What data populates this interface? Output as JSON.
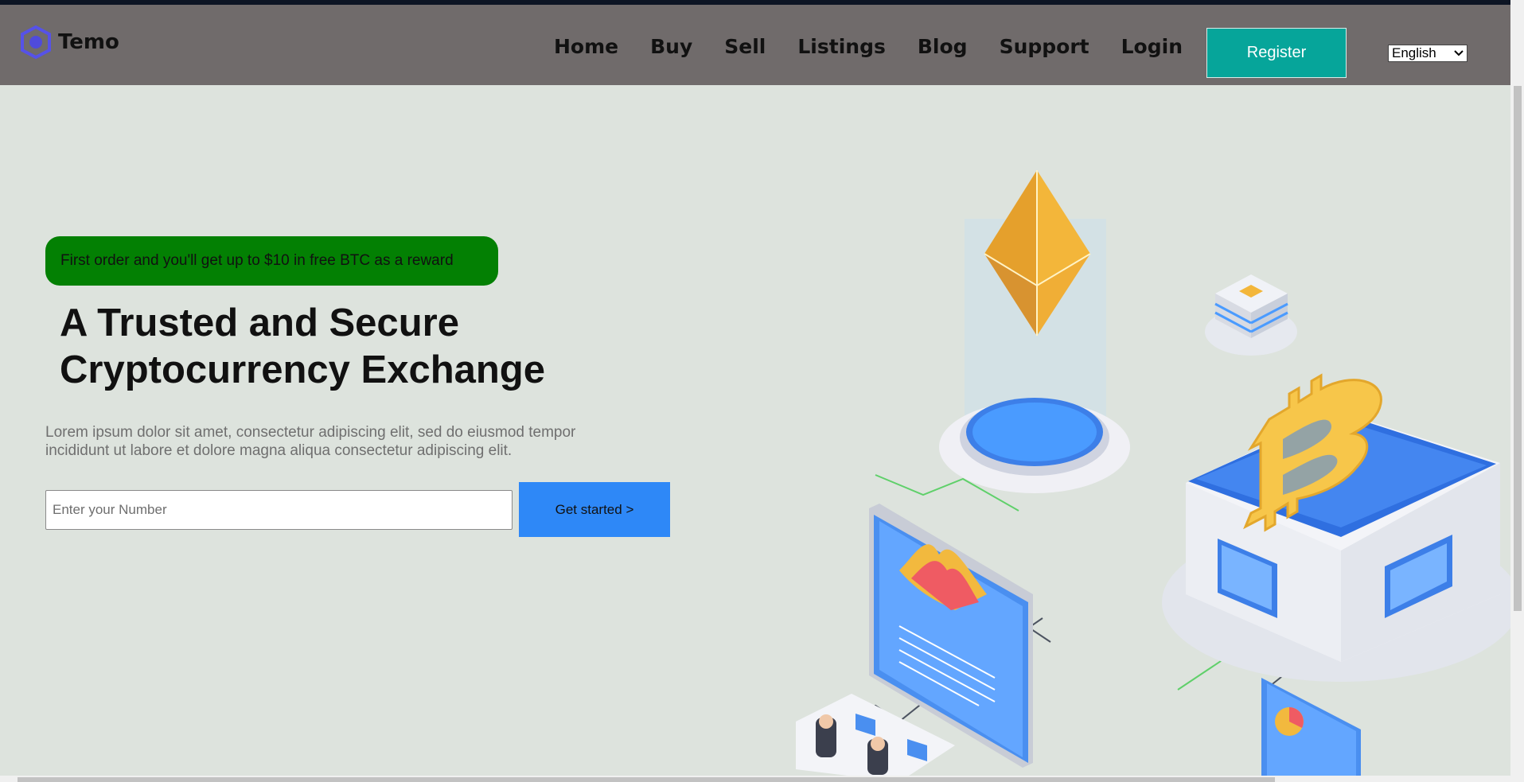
{
  "brand": {
    "name": "Temo"
  },
  "nav": {
    "links": [
      "Home",
      "Buy",
      "Sell",
      "Listings",
      "Blog",
      "Support",
      "Login"
    ],
    "register_label": "Register",
    "language": "English"
  },
  "hero": {
    "promo": "First order and you'll get up to $10 in free BTC as a reward",
    "headline_line1": "A Trusted and Secure",
    "headline_line2": "Cryptocurrency Exchange",
    "description_line1": "Lorem ipsum dolor sit amet, consectetur adipiscing elit, sed do eiusmod tempor",
    "description_line2": "incididunt ut labore et dolore magna aliqua consectetur adipiscing elit.",
    "input_placeholder": "Enter your Number",
    "cta_label": "Get started >"
  },
  "colors": {
    "navbar": "#706b6b",
    "page_background": "#dde3dd",
    "register_button": "#06a59a",
    "promo_background": "#038003",
    "cta_button": "#2e88f7"
  },
  "illustration": {
    "label": "crypto-exchange-isometric-illustration",
    "icons": [
      "ethereum-icon",
      "bitcoin-icon",
      "server-block-icon",
      "chart-screen-icon",
      "pie-chart-screen-icon"
    ]
  }
}
